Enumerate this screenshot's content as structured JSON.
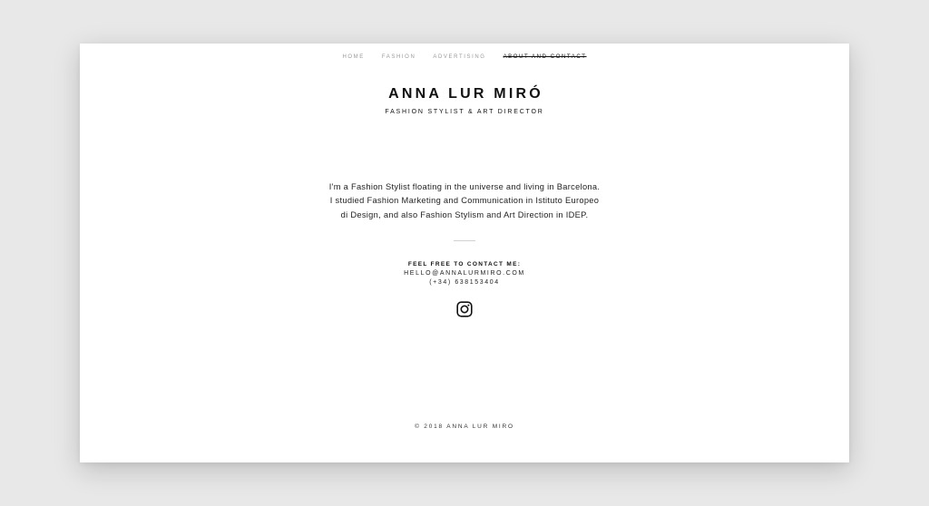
{
  "nav": {
    "items": [
      {
        "label": "HOME",
        "active": false
      },
      {
        "label": "FASHION",
        "active": false
      },
      {
        "label": "ADVERTISING",
        "active": false
      },
      {
        "label": "ABOUT AND CONTACT",
        "active": true
      }
    ]
  },
  "brand": {
    "name": "ANNA LUR MIRÓ",
    "tagline": "FASHION STYLIST & ART DIRECTOR"
  },
  "bio": {
    "lines": [
      "I'm a Fashion Stylist floating in the universe and living in Barcelona.",
      "I studied Fashion Marketing and Communication in Istituto Europeo",
      "di Design, and also Fashion Stylism and Art Direction in IDEP."
    ]
  },
  "contact": {
    "title": "FEEL FREE TO CONTACT ME:",
    "email": "HELLO@ANNALURMIRO.COM",
    "phone": "(+34) 638153404"
  },
  "social": {
    "icon": "instagram-icon"
  },
  "footer": {
    "copyright": "© 2018 ANNA LUR MIRO"
  }
}
